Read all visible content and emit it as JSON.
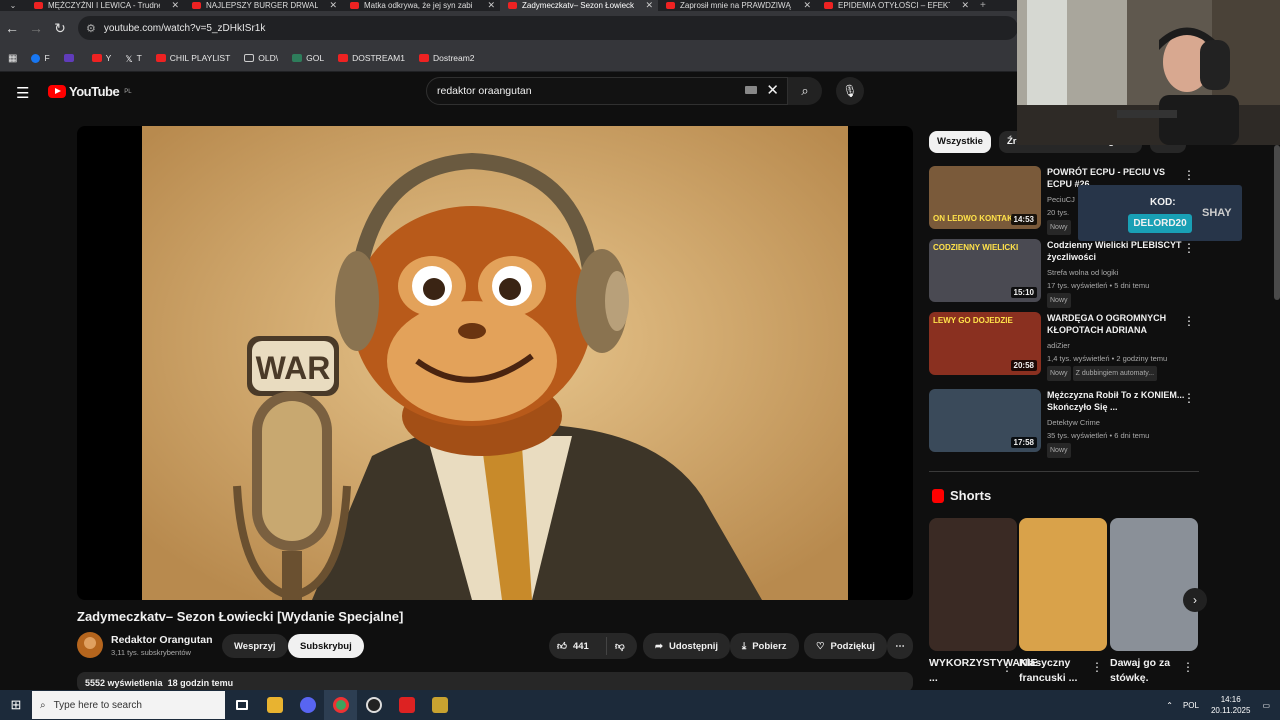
{
  "browser": {
    "tabs": [
      {
        "title": "MĘŻCZYŹNI I LEWICA - Trudne",
        "active": false
      },
      {
        "title": "NAJLEPSZY BURGER DRWALA W",
        "active": false
      },
      {
        "title": "Matka odkrywa, że jej syn zabi",
        "active": false
      },
      {
        "title": "Zadymeczkatv– Sezon Łowieck",
        "active": true
      },
      {
        "title": "Zaprosił mnie na PRAWDZIWĄ",
        "active": false
      },
      {
        "title": "EPIDEMIA OTYŁOŚCI – EFEKT L",
        "active": false
      }
    ],
    "url": "youtube.com/watch?v=5_zDHkISr1k",
    "bookmarks": [
      {
        "label": "F",
        "icon": "facebook-icon"
      },
      {
        "label": "",
        "icon": "twitch-icon"
      },
      {
        "label": "Y",
        "icon": "youtube-icon"
      },
      {
        "label": "T",
        "icon": "x-icon"
      },
      {
        "label": "CHIL PLAYLIST",
        "icon": "youtube-icon"
      },
      {
        "label": "OLD\\",
        "icon": "folder-icon"
      },
      {
        "label": "GOL",
        "icon": "gol-icon"
      },
      {
        "label": "DOSTREAM1",
        "icon": "youtube-icon"
      },
      {
        "label": "Dostream2",
        "icon": "youtube-icon"
      }
    ]
  },
  "youtube": {
    "logo_text": "YouTube",
    "region": "PL",
    "search_value": "redaktor oraangutan"
  },
  "video": {
    "title": "Zadymeczkatv– Sezon Łowiecki [Wydanie Specjalne]",
    "sign_text": "WAR",
    "channel_name": "Redaktor Orangutan",
    "subscribers": "3,11 tys. subskrybentów",
    "support_label": "Wesprzyj",
    "subscribe_label": "Subskrybuj",
    "likes": "441",
    "share_label": "Udostępnij",
    "download_label": "Pobierz",
    "thanks_label": "Podziękuj",
    "views": "5552 wyświetlenia",
    "age": "18 godzin temu"
  },
  "sidebar": {
    "chips": [
      "Wszystkie",
      "Źródło: Redaktor Orangutan",
      "Pow"
    ],
    "recommendations": [
      {
        "title": "POWRÓT ECPU - PECIU VS ECPU #26",
        "channel": "PeciuCJ",
        "meta": "20 tys.",
        "badge": "Nowy",
        "duration": "14:53",
        "thumb_text": "ON LEDWO KONTAK",
        "thumb_color": "#7a5a3a"
      },
      {
        "title": "Codzienny Wielicki PLEBISCYT życzliwości",
        "channel": "Strefa wolna od logiki",
        "meta": "17 tys. wyświetleń • 5 dni temu",
        "badge": "Nowy",
        "duration": "15:10",
        "thumb_text": "CODZIENNY WIELICKI",
        "thumb_color": "#4a4a52"
      },
      {
        "title": "WARDĘGA O OGROMNYCH KŁOPOTACH ADRIANA POLAKA",
        "channel": "adiZier",
        "meta": "1,4 tys. wyświetleń • 2 godziny temu",
        "badge": "Nowy",
        "extra": "Z dubbingiem automaty...",
        "duration": "20:58",
        "thumb_text": "LEWY GO DOJEDZIE",
        "thumb_color": "#8a3020"
      },
      {
        "title": "Mężczyzna Robił To z KONIEM... Skończyło Się ...",
        "channel": "Detektyw Crime",
        "meta": "35 tys. wyświetleń • 6 dni temu",
        "badge": "Nowy",
        "duration": "17:58",
        "thumb_text": "",
        "thumb_color": "#3a4a5a"
      }
    ],
    "promo": {
      "label": "KOD:",
      "code": "DELORD20",
      "brand": "SHAY"
    },
    "shorts_heading": "Shorts",
    "shorts": [
      {
        "title": "WYKORZYSTYWANIE ...",
        "color": "#3a2a24"
      },
      {
        "title": "Klasyczny francuski ...",
        "color": "#d9a24a"
      },
      {
        "title": "Dawaj go za stówkę.",
        "color": "#8a9098"
      }
    ]
  },
  "taskbar": {
    "search_placeholder": "Type here to search",
    "language": "POL",
    "time": "14:16",
    "date": "20.11.2025"
  }
}
